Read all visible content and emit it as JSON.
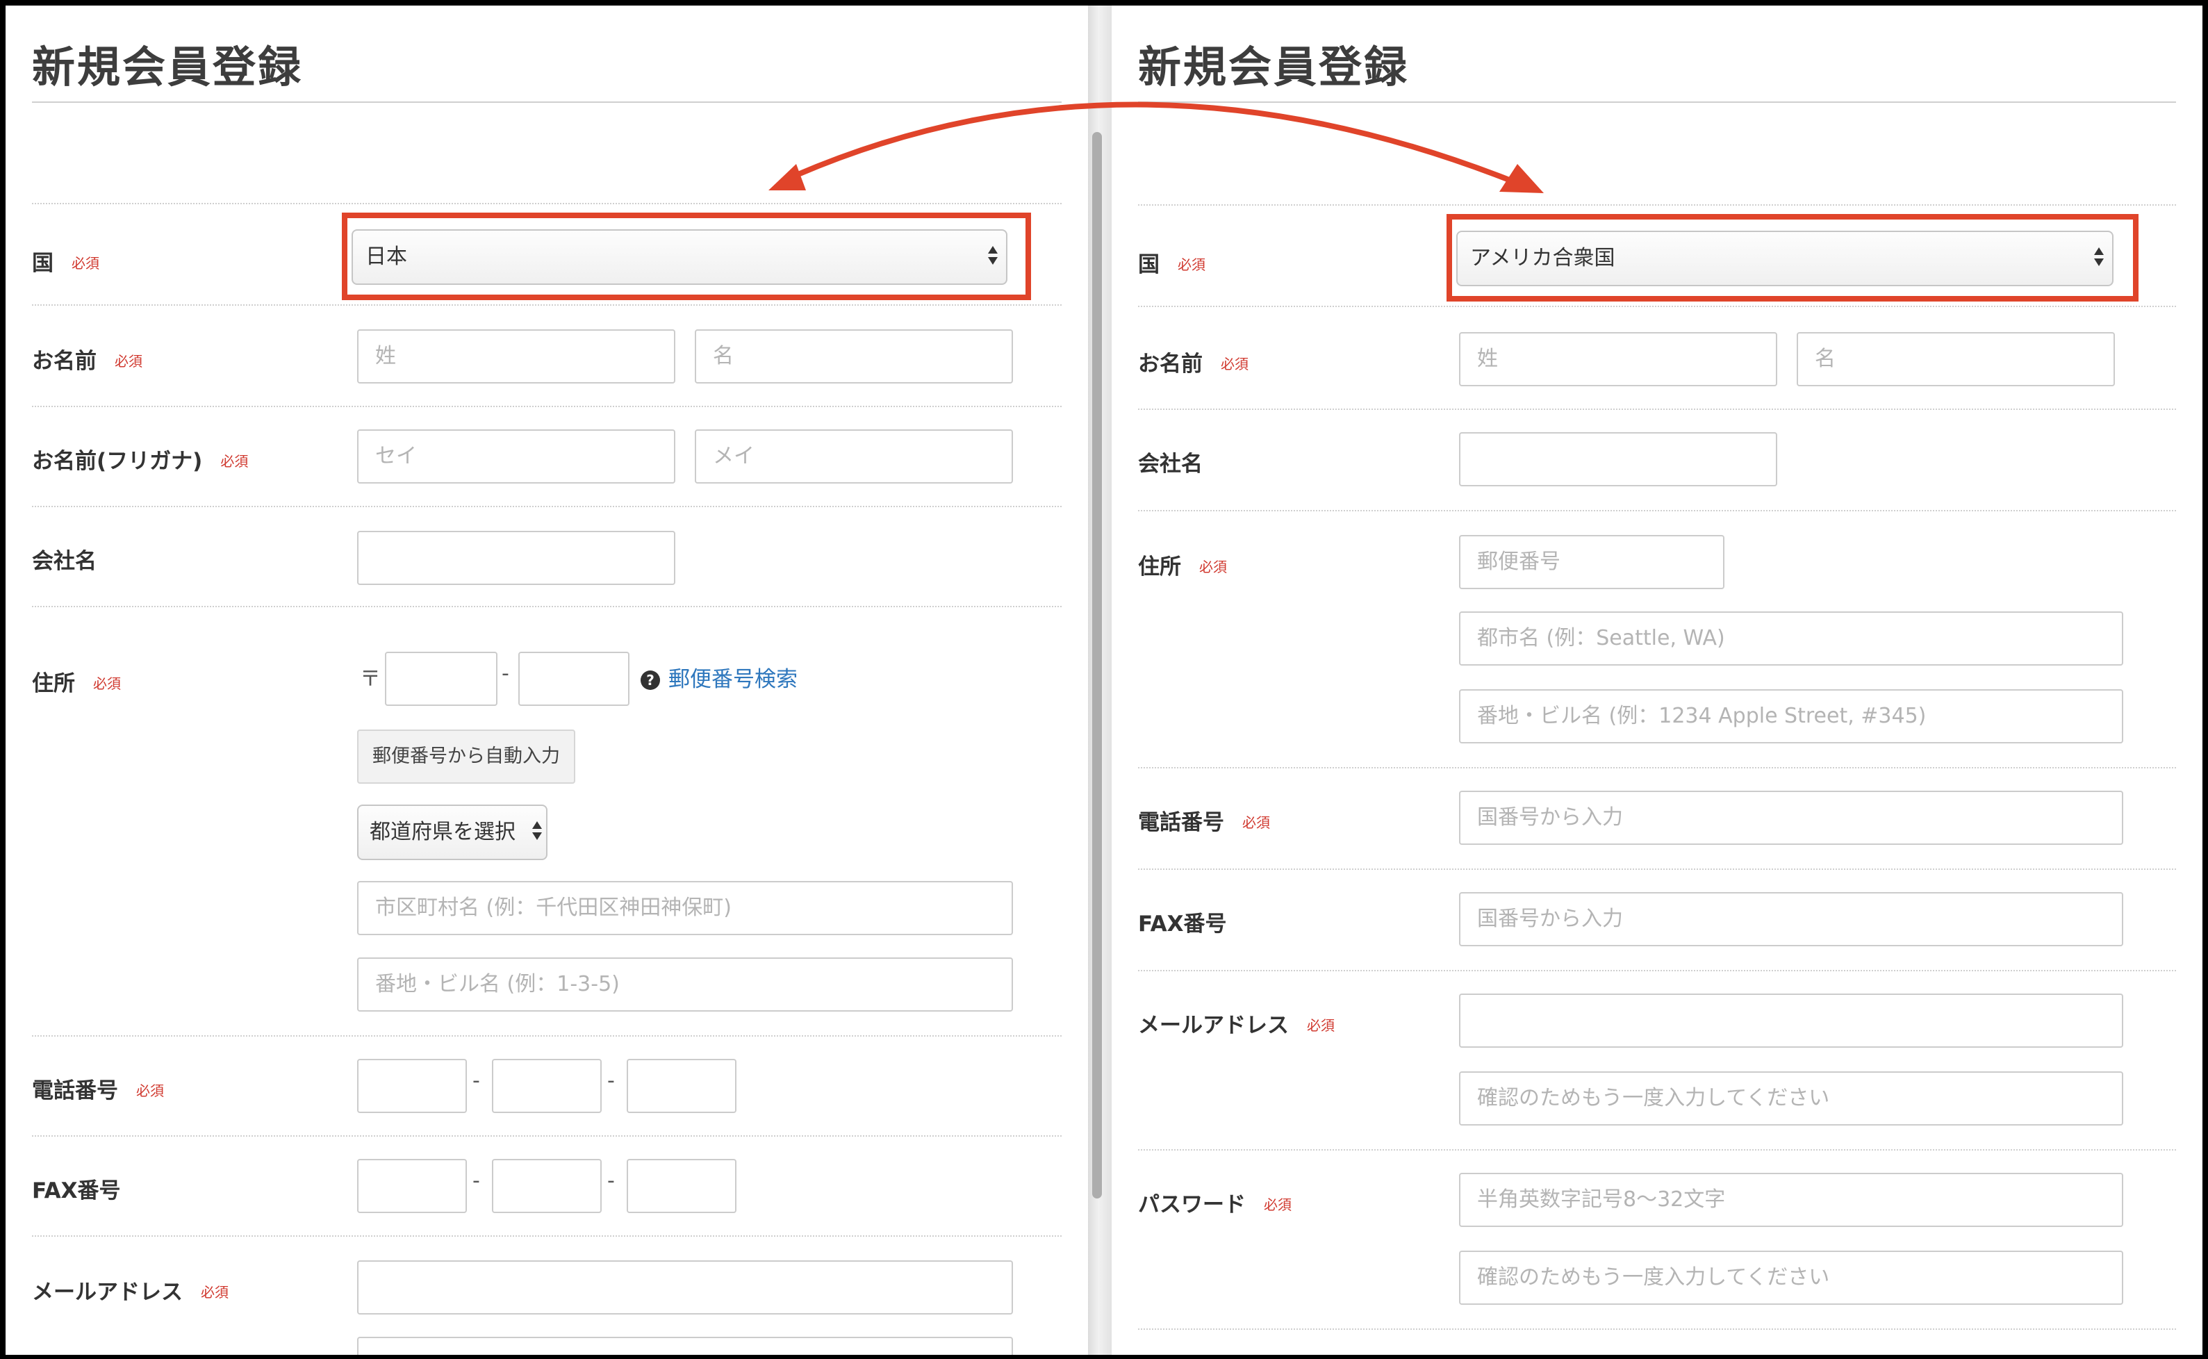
{
  "left": {
    "title": "新規会員登録",
    "required": "必須",
    "labels": {
      "country": "国",
      "name": "お名前",
      "furigana": "お名前(フリガナ)",
      "company": "会社名",
      "address": "住所",
      "phone": "電話番号",
      "fax": "FAX番号",
      "email": "メールアドレス"
    },
    "country_value": "日本",
    "placeholders": {
      "last_name": "姓",
      "first_name": "名",
      "last_kana": "セイ",
      "first_kana": "メイ",
      "city": "市区町村名 (例：千代田区神田神保町)",
      "street": "番地・ビル名 (例：1-3-5)"
    },
    "postal_mark": "〒",
    "dash": "-",
    "postal_search_link": "郵便番号検索",
    "postal_search_icon": "question-circle-icon",
    "auto_fill_button": "郵便番号から自動入力",
    "prefecture_select": "都道府県を選択"
  },
  "right": {
    "title": "新規会員登録",
    "required": "必須",
    "labels": {
      "country": "国",
      "name": "お名前",
      "company": "会社名",
      "address": "住所",
      "phone": "電話番号",
      "fax": "FAX番号",
      "email": "メールアドレス",
      "password": "パスワード"
    },
    "country_value": "アメリカ合衆国",
    "placeholders": {
      "last_name": "姓",
      "first_name": "名",
      "postal": "郵便番号",
      "city": "都市名 (例：Seattle, WA)",
      "street": "番地・ビル名 (例：1234 Apple Street, #345)",
      "phone": "国番号から入力",
      "fax": "国番号から入力",
      "email_confirm": "確認のためもう一度入力してください",
      "password": "半角英数字記号8〜32文字",
      "password_confirm": "確認のためもう一度入力してください"
    }
  },
  "annotation": {
    "color": "#e0442a"
  }
}
